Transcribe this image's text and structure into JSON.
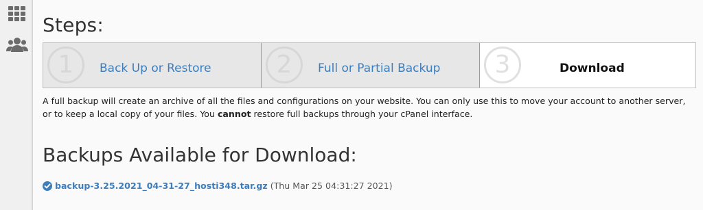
{
  "sidebar": {
    "items": [
      {
        "icon": "grid-icon"
      },
      {
        "icon": "users-icon"
      }
    ]
  },
  "steps": {
    "title": "Steps:",
    "items": [
      {
        "number": "1",
        "label": "Back Up or Restore",
        "state": "link"
      },
      {
        "number": "2",
        "label": "Full or Partial Backup",
        "state": "link"
      },
      {
        "number": "3",
        "label": "Download",
        "state": "current"
      }
    ]
  },
  "description": {
    "part1": "A full backup will create an archive of all the files and configurations on your website. You can only use this to move your account to another server, or to keep a local copy of your files. You ",
    "emphasis": "cannot",
    "part2": " restore full backups through your cPanel interface."
  },
  "backups": {
    "title": "Backups Available for Download:",
    "items": [
      {
        "filename": "backup-3.25.2021_04-31-27_hosti348.tar.gz",
        "date": "(Thu Mar 25 04:31:27 2021)",
        "status_icon": "check-circle-icon"
      }
    ]
  },
  "colors": {
    "link": "#3c7dbd",
    "step_inactive_bg": "#e7e7e7",
    "step_active_bg": "#ffffff",
    "sidebar_icon": "#6b6b6b"
  }
}
